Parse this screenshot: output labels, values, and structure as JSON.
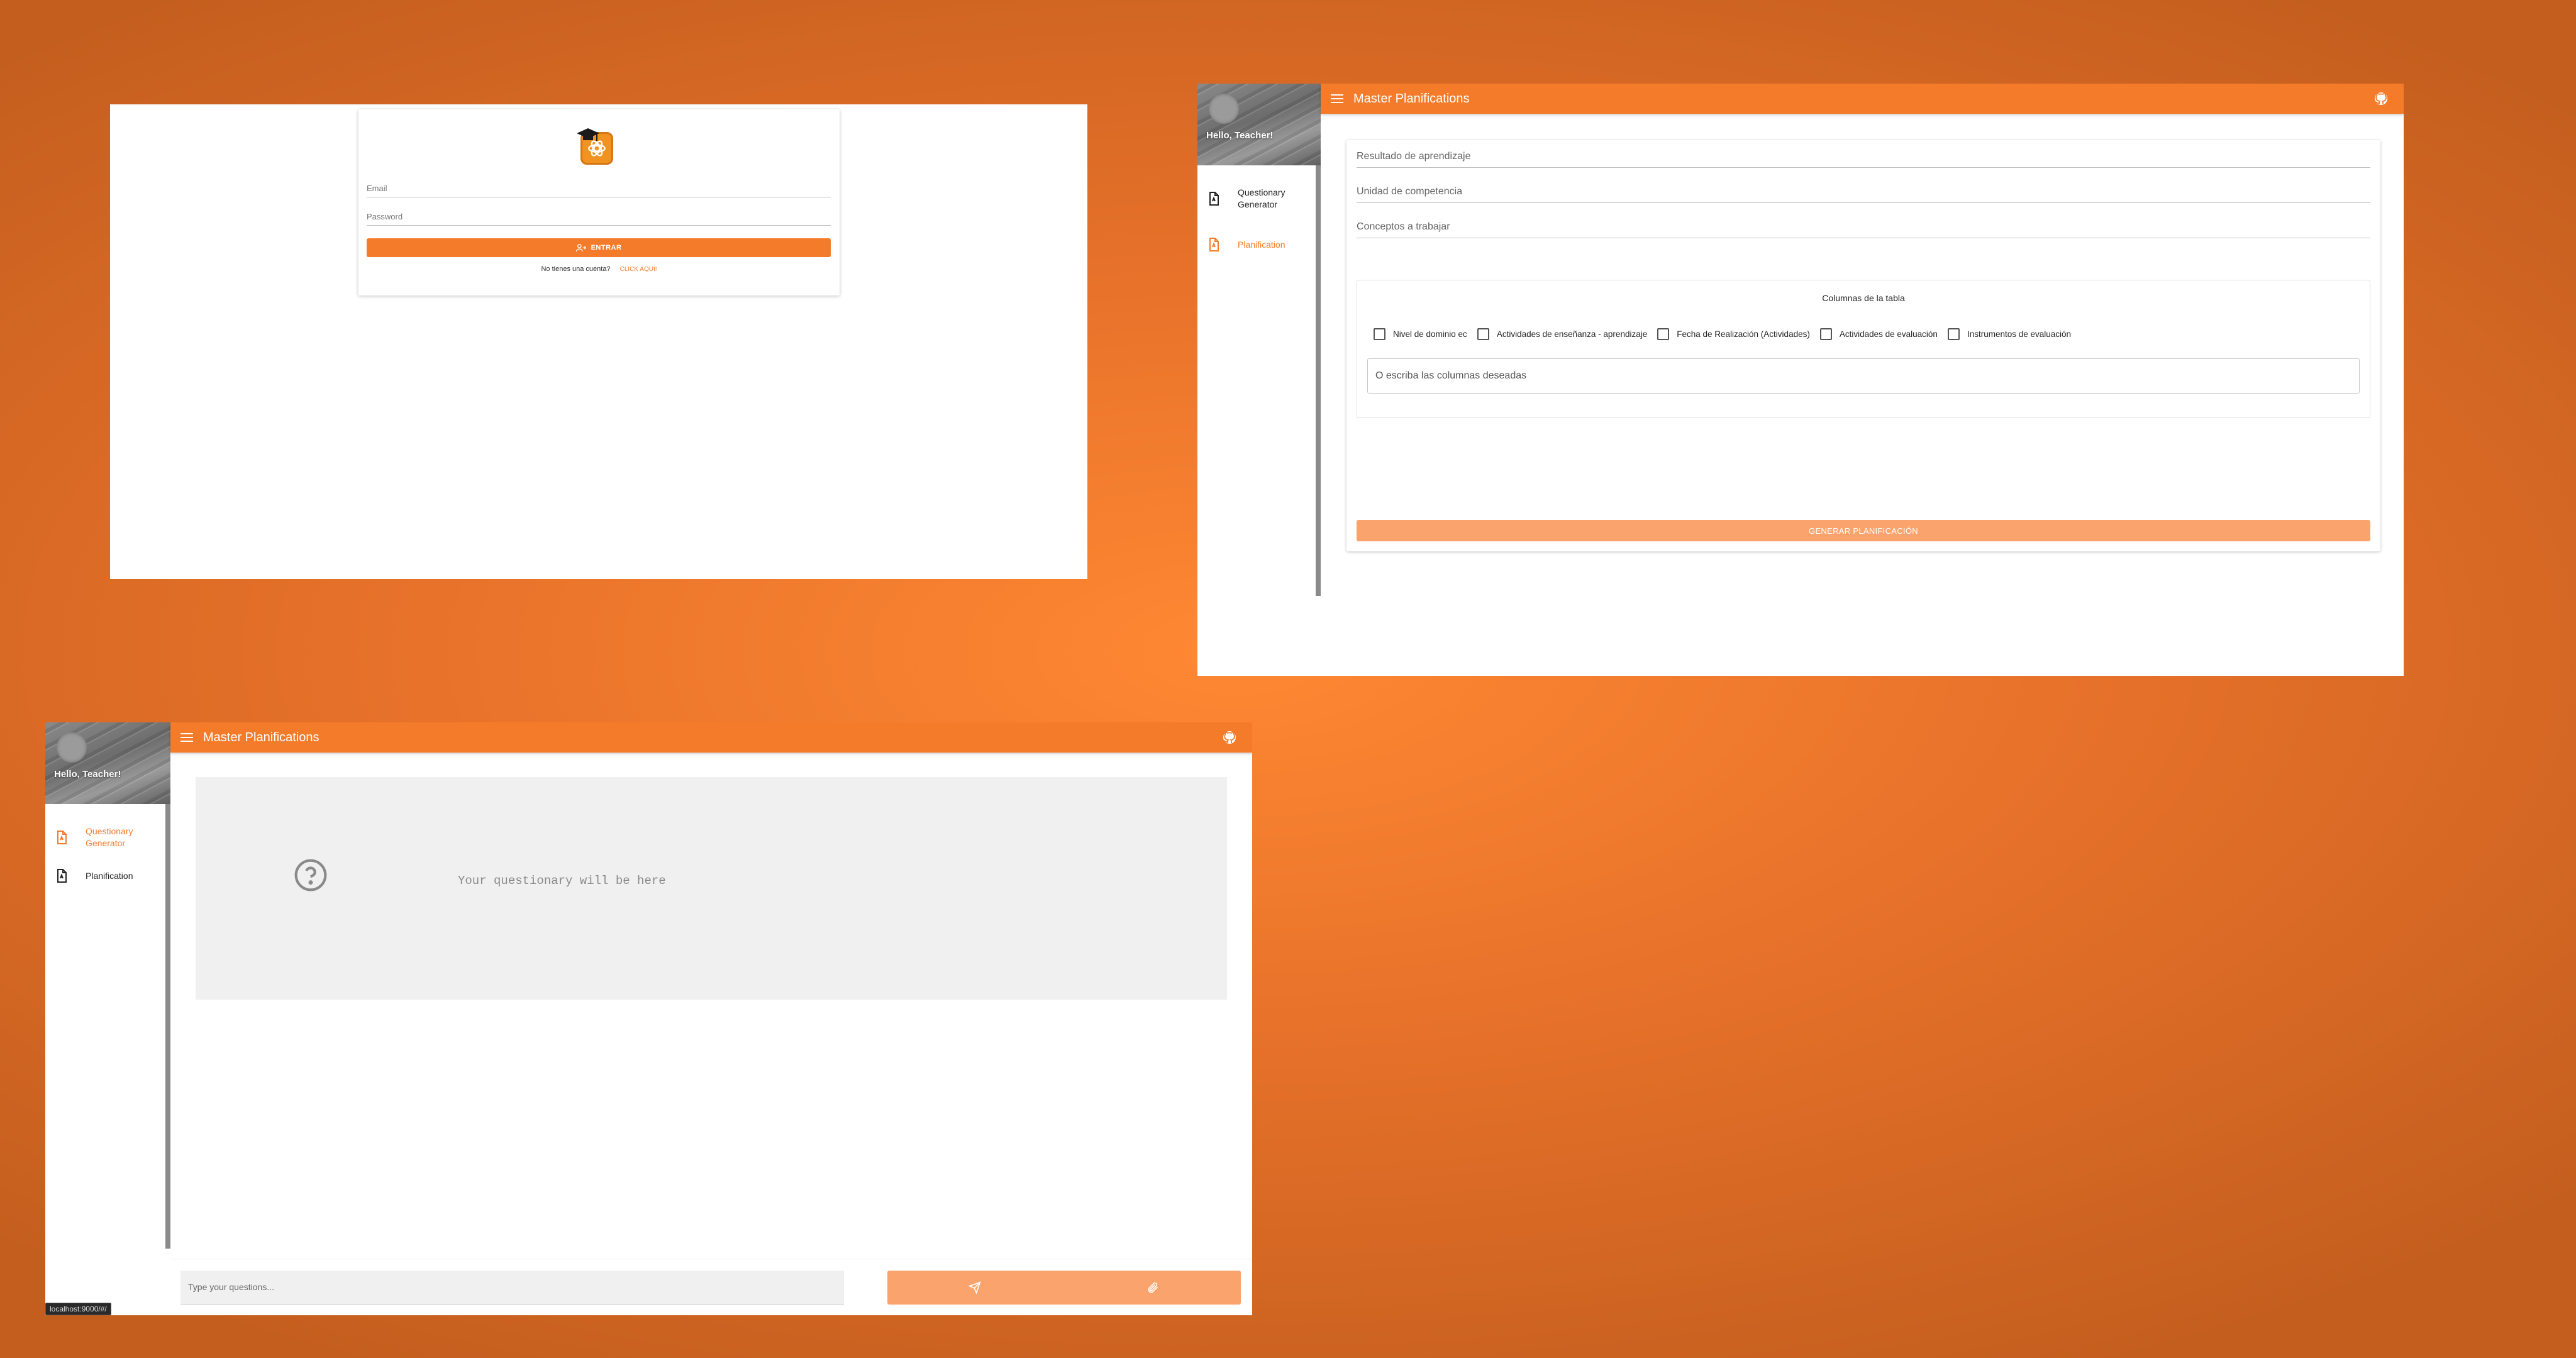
{
  "login": {
    "email_placeholder": "Email",
    "password_placeholder": "Password",
    "submit_label": "ENTRAR",
    "no_account_text": "No tienes una cuenta?",
    "signup_link": "CLICK AQUI!"
  },
  "app": {
    "title": "Master Planifications",
    "greeting": "Hello, Teacher!",
    "nav": [
      {
        "label": "Questionary Generator"
      },
      {
        "label": "Planification"
      }
    ]
  },
  "planification": {
    "fields": [
      {
        "placeholder": "Resultado de aprendizaje"
      },
      {
        "placeholder": "Unidad de competencia"
      },
      {
        "placeholder": "Conceptos a trabajar"
      }
    ],
    "columns_title": "Columnas de la tabla",
    "columns": [
      {
        "label": "Nivel de dominio ec",
        "checked": false
      },
      {
        "label": "Actividades de enseñanza - aprendizaje",
        "checked": false
      },
      {
        "label": "Fecha de Realización (Actividades)",
        "checked": false
      },
      {
        "label": "Actividades de evaluación",
        "checked": false
      },
      {
        "label": "Instrumentos de evaluación",
        "checked": false
      }
    ],
    "custom_columns_placeholder": "O escriba las columnas deseadas",
    "generate_label": "GENERAR PLANIFICACIÓN"
  },
  "questionary": {
    "placeholder_text": "Your questionary will be here",
    "input_placeholder": "Type your questions..."
  },
  "status_bar": "localhost:9000/#/",
  "colors": {
    "accent": "#f47b2a",
    "accent_light": "#fba36c"
  }
}
